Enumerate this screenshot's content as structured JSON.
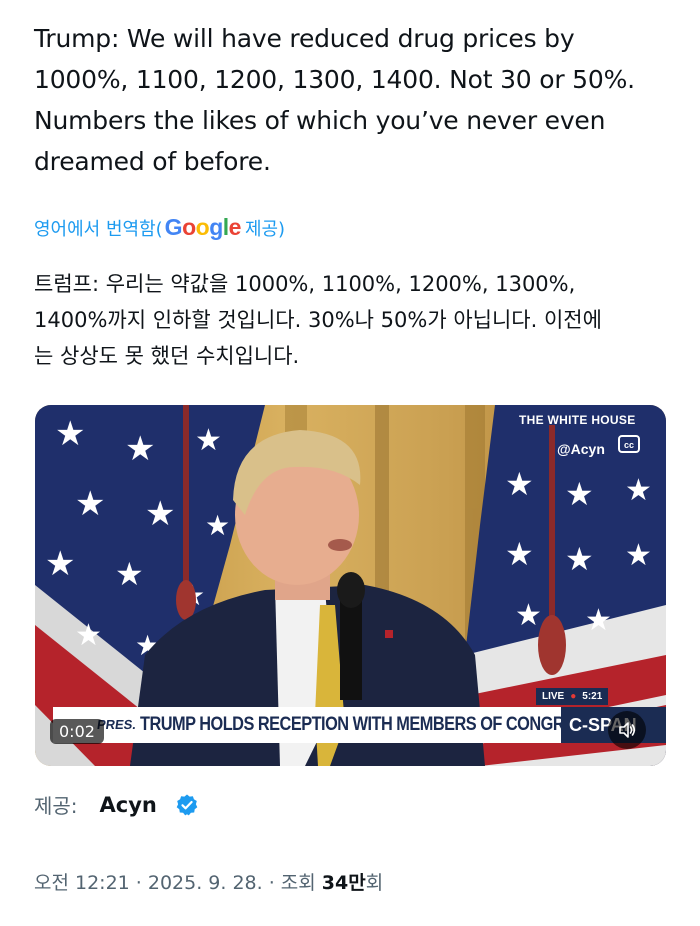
{
  "tweet": {
    "text": "Trump: We will have reduced drug prices by\n1000%, 1100, 1200, 1300, 1400. Not 30 or 50%.\nNumbers the likes of which you’ve never even\ndreamed of before.",
    "translate_prefix": "영어에서 번역함(",
    "translate_brand": [
      "G",
      "o",
      "o",
      "g",
      "l",
      "e"
    ],
    "translate_suffix": " 제공)",
    "translated_text": "트럼프: 우리는 약값을 1000%, 1100%, 1200%, 1300%,\n1400%까지 인하할 것입니다. 30%나 50%가 아닙니다. 이전에\n는 상상도 못 했던 수치입니다."
  },
  "video": {
    "watermark": "THE WHITE HOUSE",
    "handle": "@Acyn",
    "cc_icon": "closed-captions-icon",
    "live_label": "LIVE",
    "live_time": "5:21",
    "chyron_prefix": "PRES.",
    "chyron_text": "TRUMP HOLDS RECEPTION WITH MEMBERS OF CONGRESS",
    "network": "C-SPAN",
    "timecode": "0:02",
    "mute_icon": "speaker-icon"
  },
  "source": {
    "label": "제공:",
    "name": "Acyn",
    "badge_icon": "verified-badge-icon",
    "badge_color": "#1d9bf0"
  },
  "meta": {
    "time": "오전 12:21 · 2025. 9. 28. · 조회",
    "views": "34만",
    "views_unit": "회"
  },
  "colors": {
    "link_blue": "#1d9bf0",
    "google_blue": "#4285f4",
    "google_red": "#ea4335",
    "google_yellow": "#fbbc05",
    "google_green": "#34a853",
    "cspan_navy": "#1b2c53"
  }
}
